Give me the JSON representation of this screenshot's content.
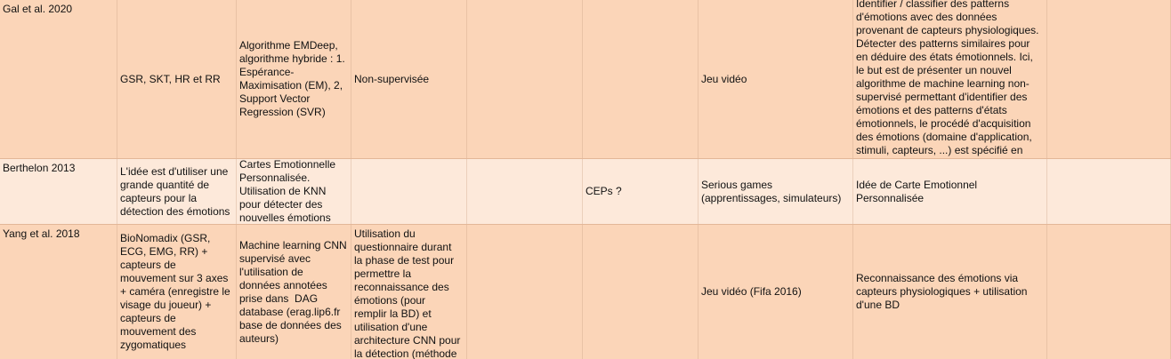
{
  "rows": [
    {
      "author": "Gal et al. 2020",
      "sensors": "GSR, SKT, HR et RR",
      "method": "Algorithme EMDeep,\nalgorithme hybride : 1.\nEspérance-\nMaximisation (EM), 2,\nSupport Vector\nRegression (SVR)",
      "supervision": "Non-supervisée",
      "col5": "",
      "cep": "",
      "context": "Jeu vidéo",
      "objective": "Identifier / classifier des patterns\nd'émotions avec des données\nprovenant de capteurs physiologiques.\nDétecter des patterns similaires pour\nen déduire des états émotionnels. Ici,\nle but est de présenter un nouvel\nalgorithme de machine learning non-\nsupervisé permettant d'identifier des\némotions et des patterns d'états\némotionnels, le procédé d'acquisition\ndes émotions (domaine d'application,\nstimuli, capteurs, ...) est spécifié en"
    },
    {
      "author": "Berthelon 2013",
      "sensors": "L'idée est d'utiliser une\ngrande quantité de\ncapteurs pour la\ndétection des émotions",
      "method": "Cartes Emotionnelle\nPersonnalisée.\nUtilisation de KNN\npour détecter des\nnouvelles émotions",
      "supervision": "",
      "col5": "",
      "cep": "CEPs ?",
      "context": "Serious games\n(apprentissages, simulateurs)",
      "objective": "Idée de Carte Emotionnel\nPersonnalisée"
    },
    {
      "author": "Yang et al. 2018",
      "sensors": "BioNomadix (GSR,\nECG, EMG, RR) +\ncapteurs de\nmouvement sur 3 axes\n+ caméra (enregistre le\nvisage du joueur) +\ncapteurs de\nmouvement des\nzygomatiques",
      "method": "Machine learning CNN\nsupervisé avec\nl'utilisation de\ndonnées annotées\nprise dans  DAG\ndatabase (erag.lip6.fr\nbase de données des\nauteurs)",
      "supervision": "Utilisation du\nquestionnaire durant\nla phase de test pour\npermettre la\nreconnaissance des\némotions (pour\nremplir la BD) et\nutilisation d'une\narchitecture CNN pour\nla détection (méthode",
      "col5": "",
      "cep": "",
      "context": "Jeu vidéo (Fifa 2016)",
      "objective": "Reconnaissance des émotions via\ncapteurs physiologiques + utilisation\nd'une BD"
    }
  ]
}
